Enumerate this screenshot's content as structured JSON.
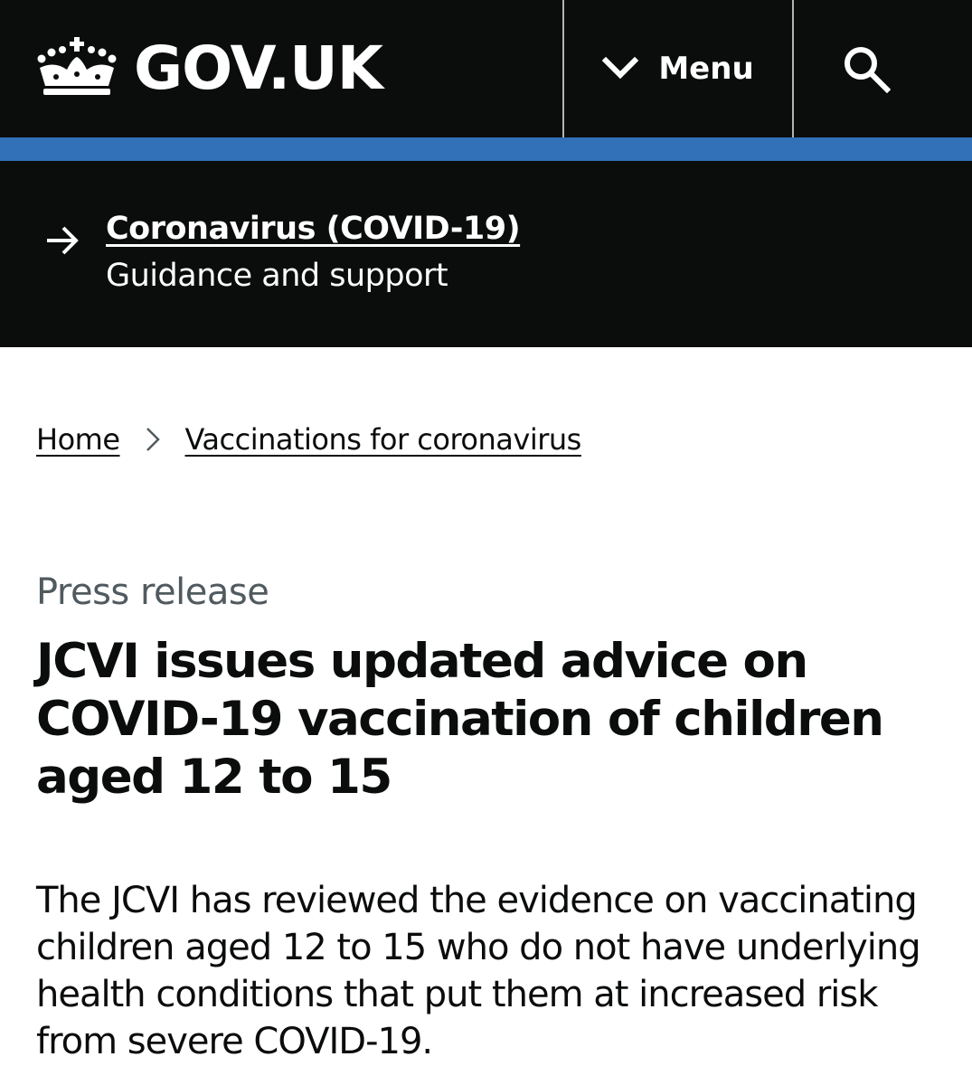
{
  "header": {
    "logo_text": "GOV.UK",
    "menu_label": "Menu"
  },
  "covid_banner": {
    "link_text": "Coronavirus (COVID-19)",
    "subtitle": "Guidance and support"
  },
  "breadcrumbs": [
    {
      "label": "Home"
    },
    {
      "label": "Vaccinations for coronavirus"
    }
  ],
  "article": {
    "caption": "Press release",
    "title": "JCVI issues updated advice on COVID-19 vaccination of children aged 12 to 15",
    "lede": "The JCVI has reviewed the evidence on vaccinating children aged 12 to 15 who do not have underlying health conditions that put them at increased risk from severe COVID-19."
  },
  "colors": {
    "header_bg": "#0b0c0c",
    "accent_bar": "#3270b8",
    "caption_text": "#505a5f"
  },
  "icons": [
    "crown-icon",
    "chevron-down-icon",
    "search-icon",
    "arrow-right-icon",
    "chevron-right-icon"
  ]
}
